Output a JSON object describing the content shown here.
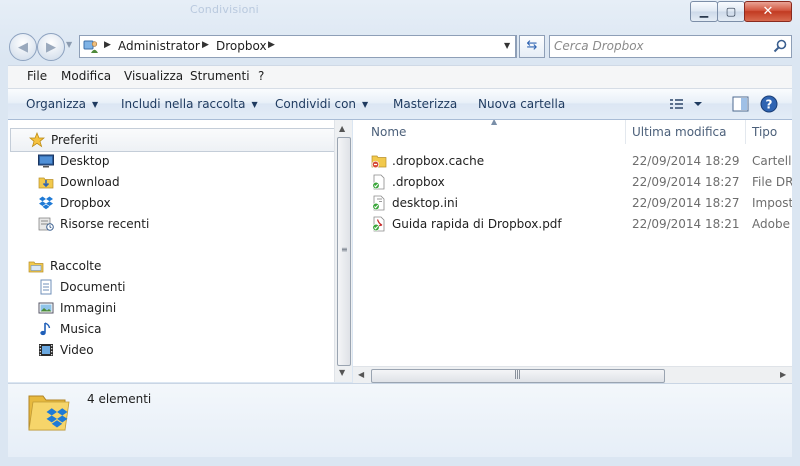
{
  "window": {
    "background_title": "Condivisioni",
    "controls": {
      "minimize": "▁",
      "maximize": "▢",
      "close": "✕"
    }
  },
  "address": {
    "segments": [
      "Administrator",
      "Dropbox"
    ],
    "search_placeholder": "Cerca Dropbox"
  },
  "menu": {
    "items": [
      "File",
      "Modifica",
      "Visualizza",
      "Strumenti",
      "?"
    ]
  },
  "toolbar": {
    "organize": "Organizza",
    "include_library": "Includi nella raccolta",
    "share_with": "Condividi con",
    "burn": "Masterizza",
    "new_folder": "Nuova cartella"
  },
  "nav": {
    "favorites_header": "Preferiti",
    "favorites": [
      {
        "label": "Desktop",
        "icon": "desktop-icon"
      },
      {
        "label": "Download",
        "icon": "downloads-icon"
      },
      {
        "label": "Dropbox",
        "icon": "dropbox-icon"
      },
      {
        "label": "Risorse recenti",
        "icon": "recent-places-icon"
      }
    ],
    "libraries_header": "Raccolte",
    "libraries": [
      {
        "label": "Documenti",
        "icon": "documents-icon"
      },
      {
        "label": "Immagini",
        "icon": "pictures-icon"
      },
      {
        "label": "Musica",
        "icon": "music-icon"
      },
      {
        "label": "Video",
        "icon": "video-icon"
      }
    ]
  },
  "files": {
    "columns": [
      "Nome",
      "Ultima modifica",
      "Tipo"
    ],
    "rows": [
      {
        "name": ".dropbox.cache",
        "modified": "22/09/2014 18:29",
        "type": "Cartella",
        "icon": "folder-sync-icon"
      },
      {
        "name": ".dropbox",
        "modified": "22/09/2014 18:27",
        "type": "File DRO",
        "icon": "file-synced-icon"
      },
      {
        "name": "desktop.ini",
        "modified": "22/09/2014 18:27",
        "type": "Imposta",
        "icon": "ini-file-synced-icon"
      },
      {
        "name": "Guida rapida di Dropbox.pdf",
        "modified": "22/09/2014 18:21",
        "type": "Adobe A",
        "icon": "pdf-file-synced-icon"
      }
    ]
  },
  "details": {
    "count": "4 elementi"
  },
  "colors": {
    "accent": "#2f64b2",
    "sync_green": "#3aa53a",
    "folder_yellow": "#f2c94c"
  }
}
